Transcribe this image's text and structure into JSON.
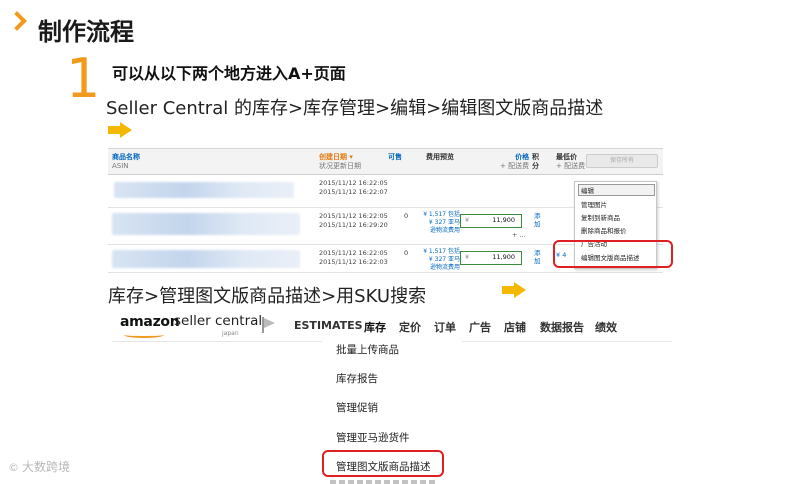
{
  "slide": {
    "title": "制作流程",
    "step_number": "1",
    "step_title": "可以从以下两个地方进入A+页面",
    "path1": "Seller Central 的库存>库存管理>编辑>编辑图文版商品描述",
    "path2": "库存>管理图文版商品描述>用SKU搜索",
    "watermark": "大数跨境",
    "accent_color": "#f29a1e",
    "highlight_color": "#e02020"
  },
  "inventory": {
    "headers": {
      "product_name": "商品名称",
      "asin": "ASIN",
      "created_date": "创建日期 ▾",
      "status_date": "状况更新日期",
      "available": "可售",
      "fee_preview": "费用预览",
      "price": "价格",
      "price_sub": "+ 配送费",
      "points": "积",
      "points2": "分",
      "lowest_price": "最低价",
      "lowest_sub": "+ 配送费",
      "save_all": "保存所有"
    },
    "rows": [
      {
        "date1": "2015/11/12 16:22:05",
        "date2": "2015/11/12 16:22:07"
      },
      {
        "date1": "2015/11/12 16:22:05",
        "date2": "2015/11/12 16:29:20",
        "available": "0",
        "fee1": "¥ 1,517 包括",
        "fee2": "¥ 327 亚马",
        "fee3": "逊物流费用",
        "yen": "¥",
        "price": "11,900",
        "link1": "添",
        "link2": "加",
        "link3": "+ ..."
      },
      {
        "date1": "2015/11/12 16:22:05",
        "date2": "2015/11/12 16:22:03",
        "available": "0",
        "fee1": "¥ 1,517 包括",
        "fee2": "¥ 327 亚马",
        "fee3": "逊物流费用",
        "yen": "¥",
        "price": "11,900",
        "link1": "添",
        "link2": "加",
        "link3": "¥ 4"
      }
    ],
    "dropdown": [
      "编辑",
      "管理图片",
      "复制到新商品",
      "删除商品和报价",
      "广告活动",
      "编辑图文版商品描述"
    ]
  },
  "amazon": {
    "logo_main": "amazon",
    "logo_sub": "seller central",
    "logo_region": "japan",
    "nav": [
      "ESTIMATES",
      "库存",
      "定价",
      "订单",
      "广告",
      "店铺",
      "数据报告",
      "绩效"
    ],
    "menu": [
      "批量上传商品",
      "库存报告",
      "管理促销",
      "管理亚马逊货件",
      "管理图文版商品描述"
    ]
  }
}
